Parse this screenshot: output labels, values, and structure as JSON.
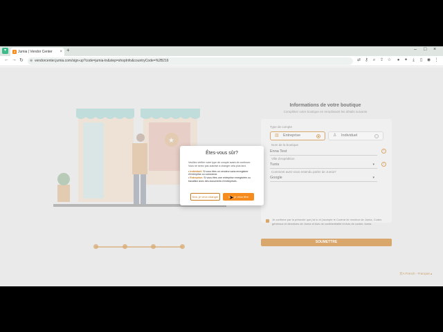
{
  "browser": {
    "tab_title": "Jumia | Vendor Center",
    "tab_favicon": "J",
    "new_tab": "+",
    "url": "vendorcenter.jumia.com/sign-up?code=jumia-tn&step=shopInfo&countryCode=%2B216"
  },
  "form": {
    "title": "Informations de votre boutique",
    "subtitle": "Complétez votre boutique en remplissant les détails suivants",
    "account_type_label": "Type de compte",
    "account_types": [
      {
        "label": "Entreprise",
        "selected": true,
        "icon": "building-icon"
      },
      {
        "label": "Individuel",
        "selected": false,
        "icon": "person-icon"
      }
    ],
    "shop_name_label": "Nom de la boutique",
    "shop_name_value": "Enna Test",
    "city_label": "Ville d'expédition",
    "city_value": "Tunis",
    "source_label": "Comment avez-vous entendu parler de Jumia?",
    "source_value": "Google",
    "consent_text": "Je confirme par la présente que j'ai lu et j'accepte le Contrat de vendeur de Jumia, Codes généraux et directives de Jumia et Avis de confidentialité et Avis de cookie Jumia.",
    "submit_label": "SOUMETTRE"
  },
  "language": "French - Français",
  "modal": {
    "title": "Êtes-vous sûr?",
    "body": "Veuillez vérifier votre type de compte avant de continuer. Vous ne serez pas autorisé à changer cela plus tard.",
    "option1_label": "Individuel:",
    "option1_text": "Si vous êtes un vendeur sans enregistrer d'entreprise ou commerce.",
    "option2_label": "Entreprise:",
    "option2_text": "Si vous êtes une entreprise enregistrée ou travaillez avec des documents d'entreprises.",
    "stay_label": "Non, je veux changer",
    "confirm_label": "Oui, je veux être"
  },
  "colors": {
    "accent": "#f68b1e",
    "accent_dark": "#c87a20"
  }
}
